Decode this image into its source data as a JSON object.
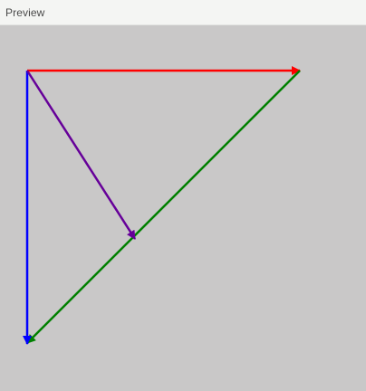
{
  "panel": {
    "title": "Preview"
  },
  "vectors": [
    {
      "name": "red-vector",
      "color": "#ff0000",
      "from": "origin",
      "to": "top-right"
    },
    {
      "name": "blue-vector",
      "color": "#0000ff",
      "from": "origin",
      "to": "bottom-left"
    },
    {
      "name": "green-vector",
      "color": "#008000",
      "from": "top-right",
      "to": "bottom-left"
    },
    {
      "name": "purple-vector",
      "color": "#660099",
      "from": "origin",
      "to": "midpoint"
    }
  ]
}
